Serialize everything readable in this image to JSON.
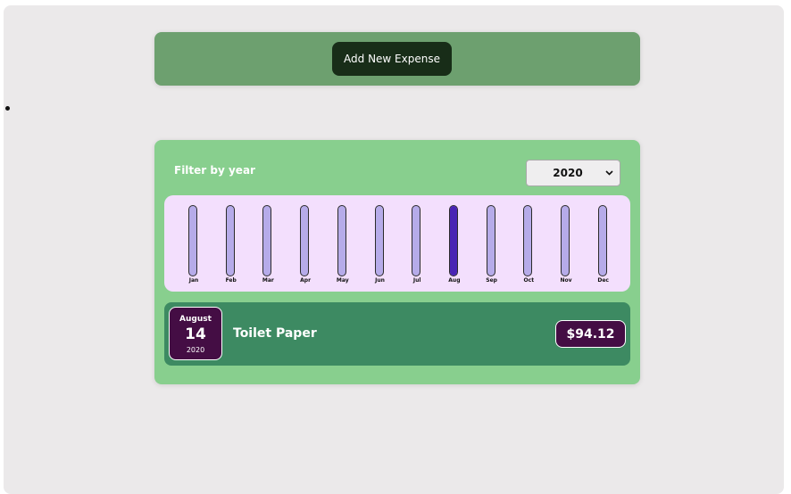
{
  "new_expense": {
    "button_label": "Add New Expense"
  },
  "filter": {
    "label": "Filter by year",
    "selected_year": "2020"
  },
  "chart_data": {
    "type": "bar",
    "categories": [
      "Jan",
      "Feb",
      "Mar",
      "Apr",
      "May",
      "Jun",
      "Jul",
      "Aug",
      "Sep",
      "Oct",
      "Nov",
      "Dec"
    ],
    "values": [
      0,
      0,
      0,
      0,
      0,
      0,
      0,
      94.12,
      0,
      0,
      0,
      0
    ],
    "max_value": 94.12
  },
  "expenses": [
    {
      "month": "August",
      "day": "14",
      "year": "2020",
      "title": "Toilet Paper",
      "amount": "$94.12"
    }
  ],
  "icons": {
    "year_select_arrow": "chevron-down-icon",
    "bullet": "bullet-icon"
  },
  "colors": {
    "page_background": "#ebe9ea",
    "new_expense_panel": "#6da06f",
    "add_button": "#182d18",
    "expenses_panel": "#88cf8e",
    "chart_background": "#f3dffd",
    "bar_empty": "#b6abe9",
    "bar_fill": "#4824b4",
    "expense_item": "#3d8a62",
    "date_badge": "#440d44"
  }
}
